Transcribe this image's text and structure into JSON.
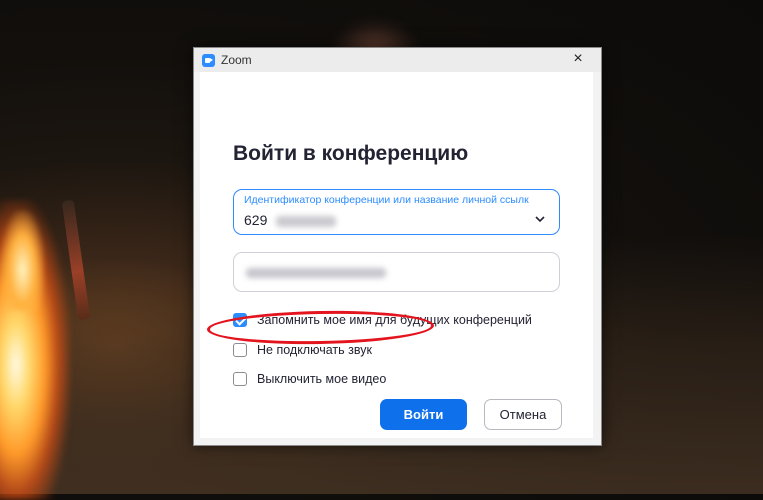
{
  "window": {
    "title": "Zoom",
    "close_symbol": "×",
    "icon": "zoom-logo-icon"
  },
  "dialog": {
    "heading": "Войти в конференцию",
    "meeting_id_field": {
      "label": "Идентификатор конференции или название личной ссылк",
      "value": "629"
    },
    "options": [
      {
        "label": "Запомнить мое имя для будущих конференций",
        "checked": true
      },
      {
        "label": "Не подключать звук",
        "checked": false
      },
      {
        "label": "Выключить мое видео",
        "checked": false
      }
    ],
    "join_label": "Войти",
    "cancel_label": "Отмена"
  },
  "colors": {
    "accent": "#2d8cff",
    "join_button": "#0e71eb",
    "highlight_ellipse": "#e3141d"
  }
}
